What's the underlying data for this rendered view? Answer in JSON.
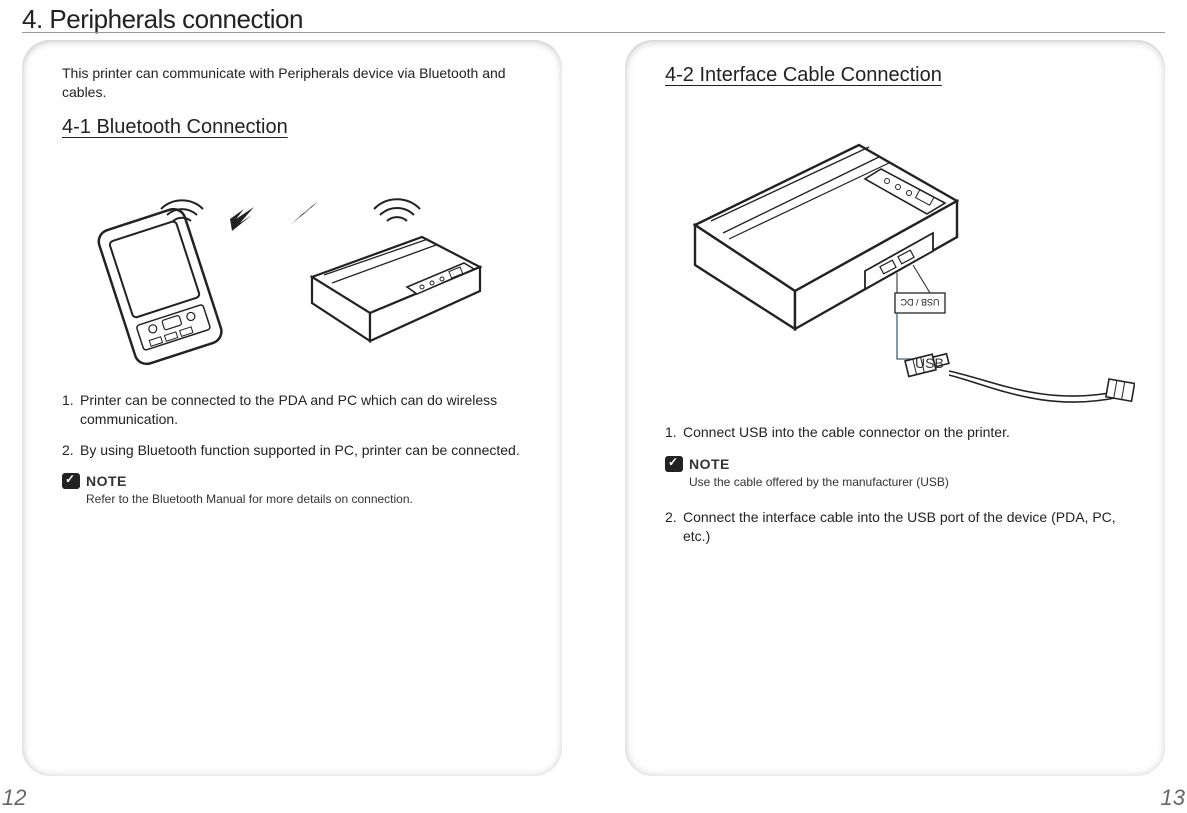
{
  "section_title": "4. Peripherals connection",
  "left": {
    "intro": "This printer can communicate with Peripherals device via Bluetooth and cables.",
    "sub_heading": "4-1 Bluetooth Connection",
    "step1_num": "1.",
    "step1_txt": "Printer can be connected to the PDA and PC which can do wireless communication.",
    "step2_num": "2.",
    "step2_txt": "By using Bluetooth function supported in PC, printer can be connected.",
    "note_label": "NOTE",
    "note_text": "Refer to the Bluetooth Manual for more details on connection."
  },
  "right": {
    "sub_heading": "4-2 Interface Cable Connection",
    "usb_label": "USB",
    "step1_num": "1.",
    "step1_txt": "Connect USB into the cable connector on the printer.",
    "note_label": "NOTE",
    "note_text": "Use the cable offered by the manufacturer (USB)",
    "step2_num": "2.",
    "step2_txt": "Connect the interface cable into the USB port of the device (PDA, PC, etc.)"
  },
  "page_left": "12",
  "page_right": "13"
}
